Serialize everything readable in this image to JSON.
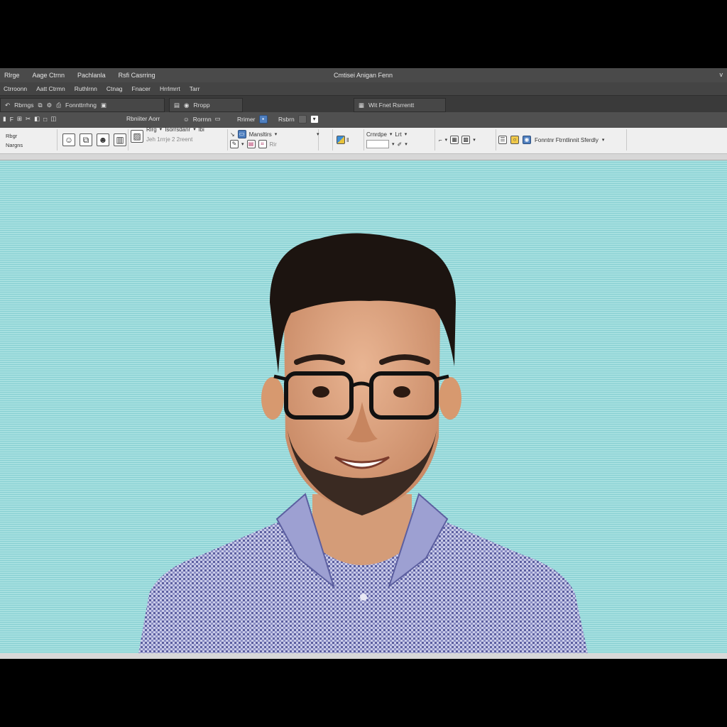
{
  "window": {
    "title": "Cmtisei Anigan Fenn",
    "menu": [
      "Rlrge",
      "Aage Ctrnn",
      "Pachlanla",
      "Rsfi Casrring"
    ],
    "control": "v"
  },
  "tabs": [
    "Ctrroonn",
    "Aatt Ctrmn",
    "Ruthlrnn",
    "Ctnag",
    "Fnacer",
    "Hrrlmrrt",
    "Tarr"
  ],
  "quickbar": {
    "left_label": "Rbrngs",
    "mid_label": "Fonnttrrhng",
    "browse_label": "Rropp",
    "doc_label": "Wit Fnet Rsrrentt"
  },
  "ribbon_top": {
    "label_a": "Rbniiter Aorr",
    "label_b": "Rorrnn",
    "label_c": "Rrimer",
    "label_d": "Rsbrn"
  },
  "ribbon": {
    "side_items": [
      "Rbgr",
      "Nargns"
    ],
    "group_b": {
      "line1": "Rlrg",
      "line2": "Isorrsdanr",
      "line3": "lbi",
      "hint": "Jeh 1rrrje 2 2reent"
    },
    "group_c": {
      "label": "Mansltirs",
      "hint": "Rir"
    },
    "group_d": {
      "label": "Crnrdpe",
      "sub": "Lrt"
    },
    "group_e": {
      "label": "Fonntnr Ftrntlinnit Sferdly"
    }
  },
  "colors": {
    "chrome_dark": "#3c3c3c",
    "ribbon_light": "#efefef",
    "canvas_cyan": "#a7e0e0"
  },
  "icons": [
    "gear-icon",
    "smiley-icon",
    "table-icon",
    "image-icon",
    "globe-icon",
    "chart-icon",
    "caret-down-icon"
  ]
}
